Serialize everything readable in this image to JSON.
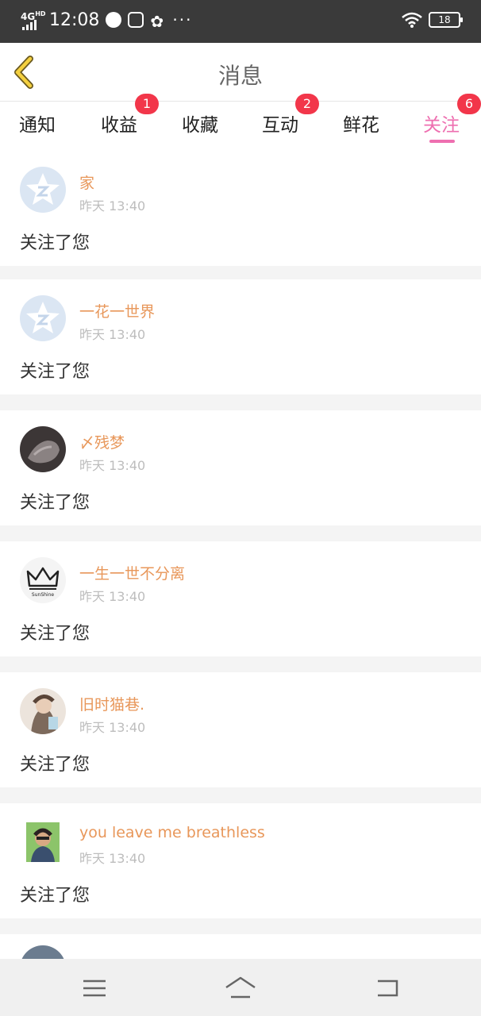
{
  "status_bar": {
    "network": "4G",
    "network_sup": "HD",
    "time": "12:08",
    "more": "···",
    "battery": "18"
  },
  "nav": {
    "title": "消息",
    "back_icon": "chevron-left-icon"
  },
  "tabs": [
    {
      "label": "通知",
      "badge": ""
    },
    {
      "label": "收益",
      "badge": "1"
    },
    {
      "label": "收藏",
      "badge": ""
    },
    {
      "label": "互动",
      "badge": "2"
    },
    {
      "label": "鲜花",
      "badge": ""
    },
    {
      "label": "关注",
      "badge": "6"
    }
  ],
  "active_tab": "关注",
  "items": [
    {
      "name": "家",
      "time": "昨天 13:40",
      "message": "关注了您"
    },
    {
      "name": "一花一世界",
      "time": "昨天 13:40",
      "message": "关注了您"
    },
    {
      "name": "〆残梦",
      "time": "昨天 13:40",
      "message": "关注了您"
    },
    {
      "name": "一生一世不分离",
      "time": "昨天 13:40",
      "message": "关注了您"
    },
    {
      "name": "旧时猫巷.",
      "time": "昨天 13:40",
      "message": "关注了您"
    },
    {
      "name": "you leave me breathless",
      "time": "昨天 13:40",
      "message": "关注了您"
    }
  ],
  "avatar4_text": "SunShine",
  "bottom_nav": [
    "menu-icon",
    "home-icon",
    "back-icon"
  ],
  "colors": {
    "accent": "#ee6fb0",
    "badge": "#f2364a",
    "nickname": "#e8975a",
    "timestamp": "#bdbdbd"
  }
}
